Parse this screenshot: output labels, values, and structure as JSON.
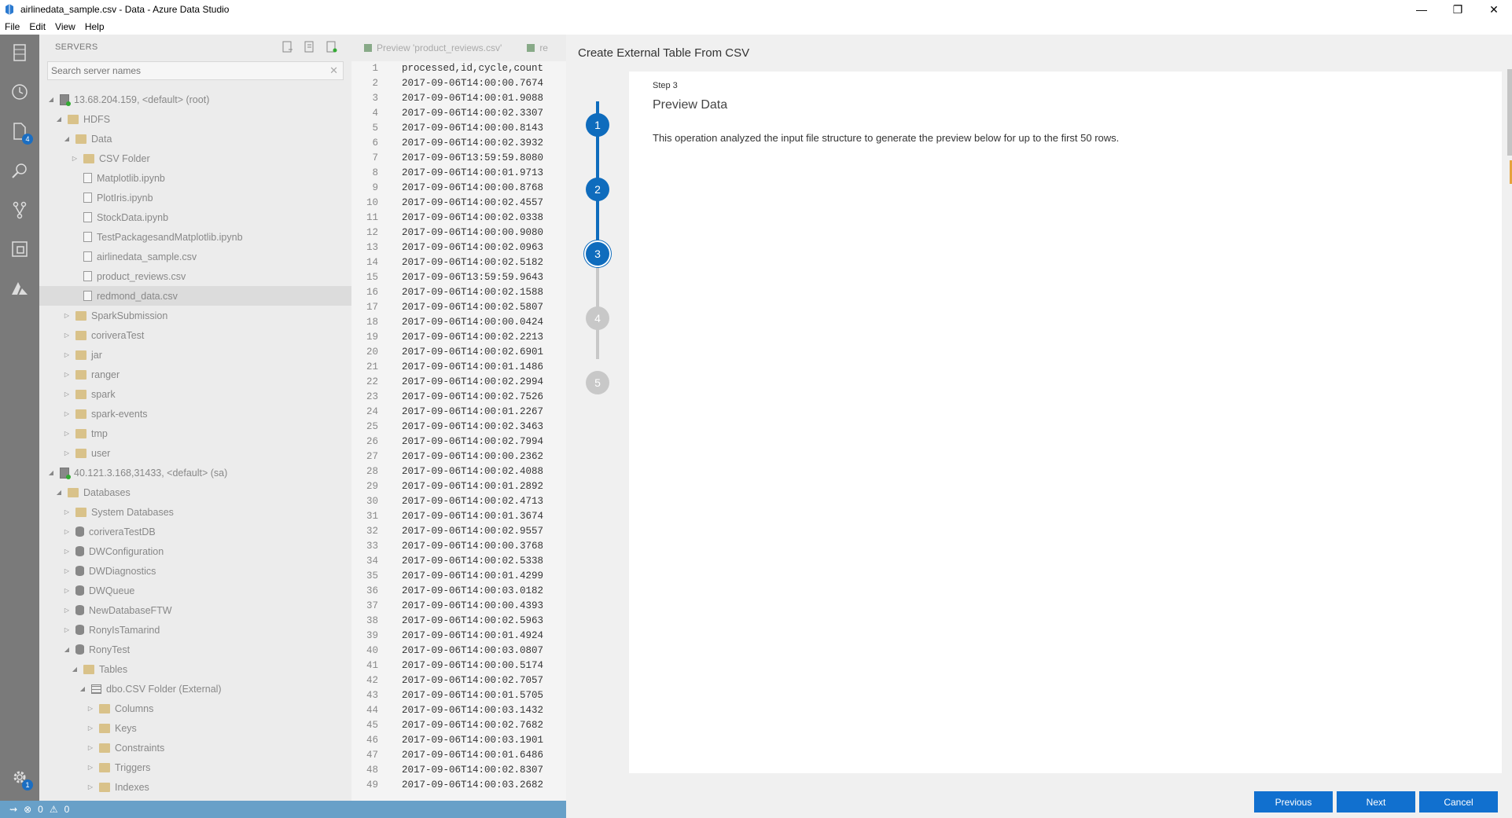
{
  "window": {
    "title": "airlinedata_sample.csv - Data - Azure Data Studio"
  },
  "menu": [
    "File",
    "Edit",
    "View",
    "Help"
  ],
  "activity": {
    "explorer_badge": "4",
    "settings_badge": "1"
  },
  "sidebar": {
    "header": "SERVERS",
    "search_placeholder": "Search server names",
    "tree": [
      {
        "indent": 0,
        "tw": "◢",
        "icon": "srv",
        "label": "13.68.204.159, <default> (root)"
      },
      {
        "indent": 1,
        "tw": "◢",
        "icon": "folder",
        "label": "HDFS"
      },
      {
        "indent": 2,
        "tw": "◢",
        "icon": "folder",
        "label": "Data"
      },
      {
        "indent": 3,
        "tw": "▷",
        "icon": "folder",
        "label": "CSV Folder"
      },
      {
        "indent": 3,
        "tw": "",
        "icon": "file",
        "label": "Matplotlib.ipynb"
      },
      {
        "indent": 3,
        "tw": "",
        "icon": "file",
        "label": "PlotIris.ipynb"
      },
      {
        "indent": 3,
        "tw": "",
        "icon": "file",
        "label": "StockData.ipynb"
      },
      {
        "indent": 3,
        "tw": "",
        "icon": "file",
        "label": "TestPackagesandMatplotlib.ipynb"
      },
      {
        "indent": 3,
        "tw": "",
        "icon": "file",
        "label": "airlinedata_sample.csv"
      },
      {
        "indent": 3,
        "tw": "",
        "icon": "file",
        "label": "product_reviews.csv"
      },
      {
        "indent": 3,
        "tw": "",
        "icon": "file",
        "label": "redmond_data.csv",
        "selected": true
      },
      {
        "indent": 2,
        "tw": "▷",
        "icon": "folder",
        "label": "SparkSubmission"
      },
      {
        "indent": 2,
        "tw": "▷",
        "icon": "folder",
        "label": "coriveraTest"
      },
      {
        "indent": 2,
        "tw": "▷",
        "icon": "folder",
        "label": "jar"
      },
      {
        "indent": 2,
        "tw": "▷",
        "icon": "folder",
        "label": "ranger"
      },
      {
        "indent": 2,
        "tw": "▷",
        "icon": "folder",
        "label": "spark"
      },
      {
        "indent": 2,
        "tw": "▷",
        "icon": "folder",
        "label": "spark-events"
      },
      {
        "indent": 2,
        "tw": "▷",
        "icon": "folder",
        "label": "tmp"
      },
      {
        "indent": 2,
        "tw": "▷",
        "icon": "folder",
        "label": "user"
      },
      {
        "indent": 0,
        "tw": "◢",
        "icon": "srv",
        "label": "40.121.3.168,31433, <default> (sa)"
      },
      {
        "indent": 1,
        "tw": "◢",
        "icon": "folder",
        "label": "Databases"
      },
      {
        "indent": 2,
        "tw": "▷",
        "icon": "folder",
        "label": "System Databases"
      },
      {
        "indent": 2,
        "tw": "▷",
        "icon": "db",
        "label": "coriveraTestDB"
      },
      {
        "indent": 2,
        "tw": "▷",
        "icon": "db",
        "label": "DWConfiguration"
      },
      {
        "indent": 2,
        "tw": "▷",
        "icon": "db",
        "label": "DWDiagnostics"
      },
      {
        "indent": 2,
        "tw": "▷",
        "icon": "db",
        "label": "DWQueue"
      },
      {
        "indent": 2,
        "tw": "▷",
        "icon": "db",
        "label": "NewDatabaseFTW"
      },
      {
        "indent": 2,
        "tw": "▷",
        "icon": "db",
        "label": "RonyIsTamarind"
      },
      {
        "indent": 2,
        "tw": "◢",
        "icon": "db",
        "label": "RonyTest"
      },
      {
        "indent": 3,
        "tw": "◢",
        "icon": "folder",
        "label": "Tables"
      },
      {
        "indent": 4,
        "tw": "◢",
        "icon": "tbl",
        "label": "dbo.CSV Folder (External)"
      },
      {
        "indent": 5,
        "tw": "▷",
        "icon": "folder",
        "label": "Columns"
      },
      {
        "indent": 5,
        "tw": "▷",
        "icon": "folder",
        "label": "Keys"
      },
      {
        "indent": 5,
        "tw": "▷",
        "icon": "folder",
        "label": "Constraints"
      },
      {
        "indent": 5,
        "tw": "▷",
        "icon": "folder",
        "label": "Triggers"
      },
      {
        "indent": 5,
        "tw": "▷",
        "icon": "folder",
        "label": "Indexes"
      }
    ]
  },
  "editor": {
    "tabs": [
      "Preview 'product_reviews.csv'",
      "re"
    ],
    "lines": [
      "processed,id,cycle,count",
      "2017-09-06T14:00:00.7674",
      "2017-09-06T14:00:01.9088",
      "2017-09-06T14:00:02.3307",
      "2017-09-06T14:00:00.8143",
      "2017-09-06T14:00:02.3932",
      "2017-09-06T13:59:59.8080",
      "2017-09-06T14:00:01.9713",
      "2017-09-06T14:00:00.8768",
      "2017-09-06T14:00:02.4557",
      "2017-09-06T14:00:02.0338",
      "2017-09-06T14:00:00.9080",
      "2017-09-06T14:00:02.0963",
      "2017-09-06T14:00:02.5182",
      "2017-09-06T13:59:59.9643",
      "2017-09-06T14:00:02.1588",
      "2017-09-06T14:00:02.5807",
      "2017-09-06T14:00:00.0424",
      "2017-09-06T14:00:02.2213",
      "2017-09-06T14:00:02.6901",
      "2017-09-06T14:00:01.1486",
      "2017-09-06T14:00:02.2994",
      "2017-09-06T14:00:02.7526",
      "2017-09-06T14:00:01.2267",
      "2017-09-06T14:00:02.3463",
      "2017-09-06T14:00:02.7994",
      "2017-09-06T14:00:00.2362",
      "2017-09-06T14:00:02.4088",
      "2017-09-06T14:00:01.2892",
      "2017-09-06T14:00:02.4713",
      "2017-09-06T14:00:01.3674",
      "2017-09-06T14:00:02.9557",
      "2017-09-06T14:00:00.3768",
      "2017-09-06T14:00:02.5338",
      "2017-09-06T14:00:01.4299",
      "2017-09-06T14:00:03.0182",
      "2017-09-06T14:00:00.4393",
      "2017-09-06T14:00:02.5963",
      "2017-09-06T14:00:01.4924",
      "2017-09-06T14:00:03.0807",
      "2017-09-06T14:00:00.5174",
      "2017-09-06T14:00:02.7057",
      "2017-09-06T14:00:01.5705",
      "2017-09-06T14:00:03.1432",
      "2017-09-06T14:00:02.7682",
      "2017-09-06T14:00:03.1901",
      "2017-09-06T14:00:01.6486",
      "2017-09-06T14:00:02.8307",
      "2017-09-06T14:00:03.2682"
    ]
  },
  "status": {
    "errors": "0",
    "warnings": "0"
  },
  "dialog": {
    "title": "Create External Table From CSV",
    "steps": [
      "1",
      "2",
      "3",
      "4",
      "5"
    ],
    "current_step": 3,
    "step_label": "Step 3",
    "step_title": "Preview Data",
    "description": "This operation analyzed the input file structure to generate the preview below for up to the first 50 rows.",
    "buttons": {
      "previous": "Previous",
      "next": "Next",
      "cancel": "Cancel"
    }
  },
  "colors": {
    "accent": "#0f6cbd",
    "status_bar": "#68a0c8",
    "activity_bar": "#7a7a7a"
  }
}
